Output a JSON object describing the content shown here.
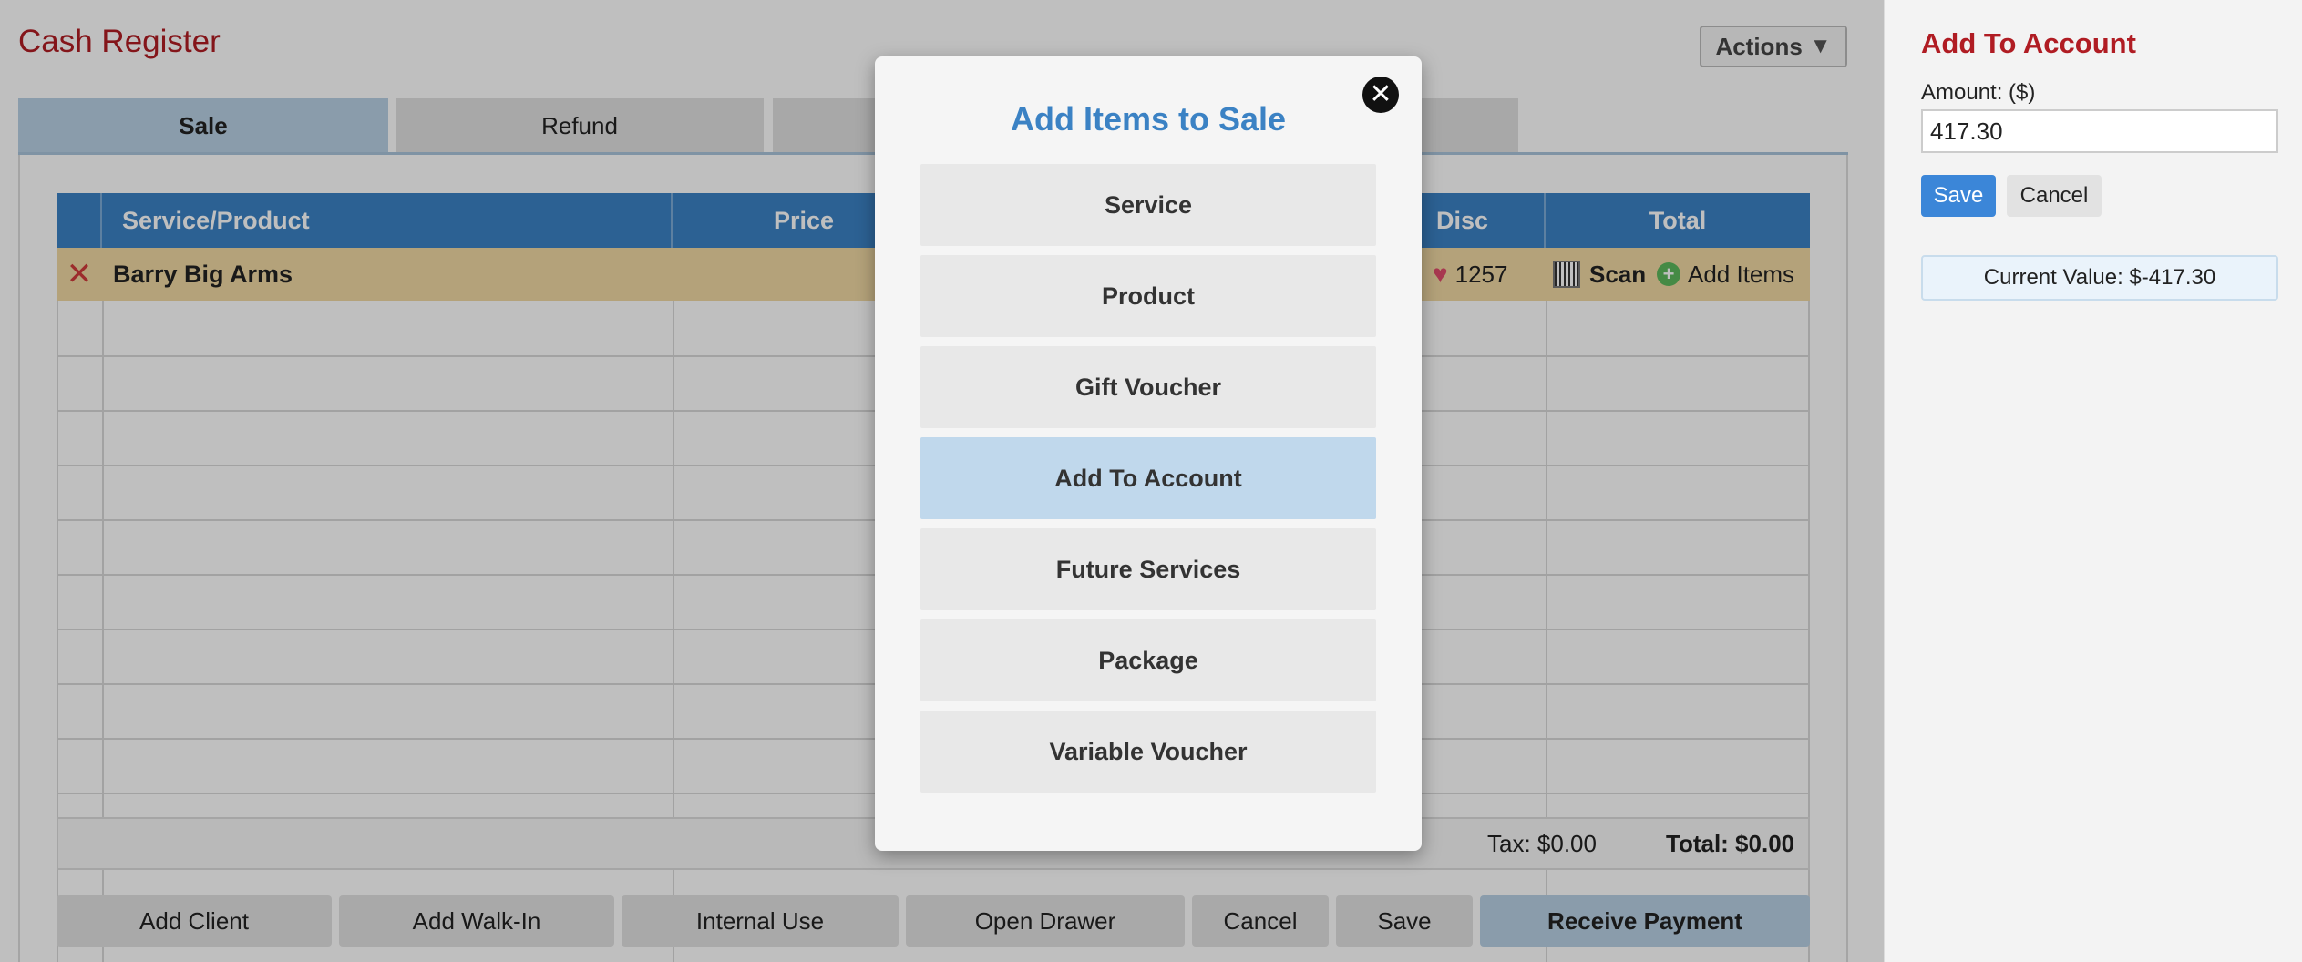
{
  "app": {
    "title": "Cash Register",
    "actions_label": "Actions"
  },
  "tabs": [
    {
      "label": "Sale",
      "active": true
    },
    {
      "label": "Refund",
      "active": false
    },
    {
      "label": "",
      "active": false
    },
    {
      "label": "",
      "active": false
    }
  ],
  "table": {
    "columns": [
      "Service/Product",
      "Price",
      "Disc",
      "Total"
    ],
    "client_row": {
      "name": "Barry Big Arms",
      "points": "1257",
      "scan_label": "Scan",
      "add_items_label": "Add Items"
    }
  },
  "totals": {
    "tax": "Tax: $0.00",
    "total": "Total: $0.00"
  },
  "bottom_buttons": [
    "Add Client",
    "Add Walk-In",
    "Internal Use",
    "Open Drawer",
    "Cancel",
    "Save",
    "Receive Payment"
  ],
  "modal": {
    "title": "Add Items to Sale",
    "close_symbol": "✕",
    "items": [
      "Service",
      "Product",
      "Gift Voucher",
      "Add To Account",
      "Future Services",
      "Package",
      "Variable Voucher"
    ],
    "highlighted": "Add To Account"
  },
  "side_panel": {
    "title": "Add To Account",
    "amount_label": "Amount: ($)",
    "amount_value": "417.30",
    "save_label": "Save",
    "cancel_label": "Cancel",
    "current_value": "Current Value: $-417.30"
  },
  "colors": {
    "brand_red": "#b01c23",
    "header_blue": "#3b82c4",
    "active_tab": "#b9d1e4",
    "highlight": "#c0d8ec"
  },
  "icons": [
    "remove-icon",
    "heart-icon",
    "barcode-icon",
    "plus-circle-icon",
    "close-icon",
    "caret-down-icon"
  ]
}
